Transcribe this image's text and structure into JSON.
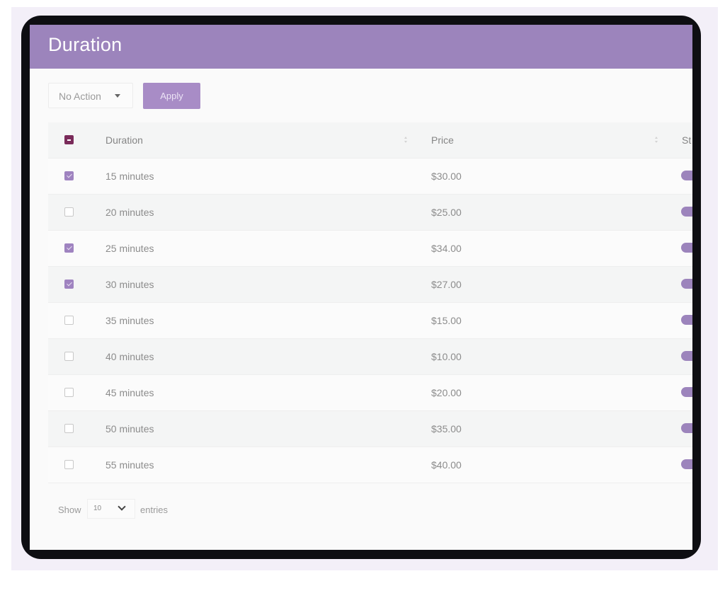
{
  "page": {
    "title": "Duration"
  },
  "toolbar": {
    "bulk_action": {
      "selected": "No Action"
    },
    "apply_label": "Apply"
  },
  "table": {
    "columns": [
      {
        "label": "Duration",
        "sortable": true
      },
      {
        "label": "Price",
        "sortable": true
      },
      {
        "label": "St",
        "sortable": false
      }
    ],
    "select_all_state": "indeterminate",
    "rows": [
      {
        "duration": "15 minutes",
        "price": "$30.00",
        "selected": true,
        "status_on": true
      },
      {
        "duration": "20 minutes",
        "price": "$25.00",
        "selected": false,
        "status_on": true
      },
      {
        "duration": "25 minutes",
        "price": "$34.00",
        "selected": true,
        "status_on": true
      },
      {
        "duration": "30 minutes",
        "price": "$27.00",
        "selected": true,
        "status_on": true
      },
      {
        "duration": "35 minutes",
        "price": "$15.00",
        "selected": false,
        "status_on": true
      },
      {
        "duration": "40 minutes",
        "price": "$10.00",
        "selected": false,
        "status_on": true
      },
      {
        "duration": "45 minutes",
        "price": "$20.00",
        "selected": false,
        "status_on": true
      },
      {
        "duration": "50 minutes",
        "price": "$35.00",
        "selected": false,
        "status_on": true
      },
      {
        "duration": "55 minutes",
        "price": "$40.00",
        "selected": false,
        "status_on": true
      }
    ]
  },
  "footer": {
    "show_label": "Show",
    "page_size": "10",
    "entries_label": "entries"
  },
  "colors": {
    "accent": "#9c84bc",
    "checkbox_checked": "#9f83c0",
    "select_all": "#7a2b5a",
    "background": "#fafafa"
  },
  "icons": {
    "bulk_caret": "caret-down-icon",
    "sort": "sort-icon",
    "page_size_chevron": "chevron-down-icon"
  }
}
